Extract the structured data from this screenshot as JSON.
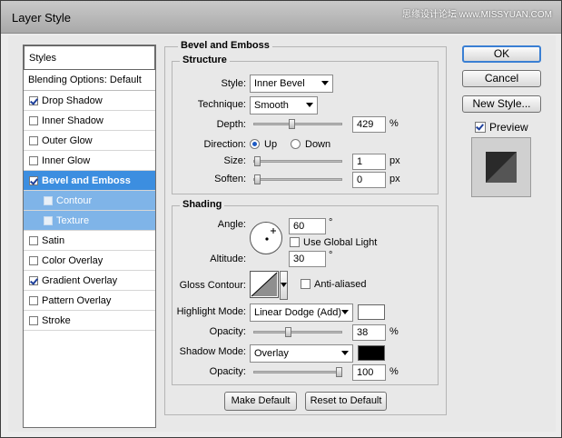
{
  "window": {
    "title": "Layer Style",
    "watermark": "思缘设计论坛 www.MISSYUAN.COM"
  },
  "sidebar": {
    "header": "Styles",
    "blending": "Blending Options: Default",
    "items": [
      {
        "label": "Drop Shadow",
        "checked": true
      },
      {
        "label": "Inner Shadow",
        "checked": false
      },
      {
        "label": "Outer Glow",
        "checked": false
      },
      {
        "label": "Inner Glow",
        "checked": false
      },
      {
        "label": "Bevel and Emboss",
        "checked": true,
        "selected": true
      },
      {
        "label": "Contour",
        "checked": false,
        "sub": true
      },
      {
        "label": "Texture",
        "checked": false,
        "sub": true
      },
      {
        "label": "Satin",
        "checked": false
      },
      {
        "label": "Color Overlay",
        "checked": false
      },
      {
        "label": "Gradient Overlay",
        "checked": true
      },
      {
        "label": "Pattern Overlay",
        "checked": false
      },
      {
        "label": "Stroke",
        "checked": false
      }
    ]
  },
  "panel": {
    "title": "Bevel and Emboss",
    "structure": {
      "title": "Structure",
      "style_label": "Style:",
      "style_value": "Inner Bevel",
      "technique_label": "Technique:",
      "technique_value": "Smooth",
      "depth_label": "Depth:",
      "depth_value": "429",
      "depth_unit": "%",
      "direction_label": "Direction:",
      "dir_up": "Up",
      "dir_down": "Down",
      "size_label": "Size:",
      "size_value": "1",
      "size_unit": "px",
      "soften_label": "Soften:",
      "soften_value": "0",
      "soften_unit": "px"
    },
    "shading": {
      "title": "Shading",
      "angle_label": "Angle:",
      "angle_value": "60",
      "angle_unit": "°",
      "global_light": "Use Global Light",
      "altitude_label": "Altitude:",
      "altitude_value": "30",
      "altitude_unit": "°",
      "gloss_label": "Gloss Contour:",
      "anti_aliased": "Anti-aliased",
      "highlight_label": "Highlight Mode:",
      "highlight_value": "Linear Dodge (Add)",
      "highlight_opacity_label": "Opacity:",
      "highlight_opacity_value": "38",
      "highlight_opacity_unit": "%",
      "highlight_color": "#ffffff",
      "shadow_label": "Shadow Mode:",
      "shadow_value": "Overlay",
      "shadow_opacity_label": "Opacity:",
      "shadow_opacity_value": "100",
      "shadow_opacity_unit": "%",
      "shadow_color": "#000000"
    },
    "make_default": "Make Default",
    "reset_default": "Reset to Default"
  },
  "buttons": {
    "ok": "OK",
    "cancel": "Cancel",
    "new_style": "New Style...",
    "preview": "Preview"
  }
}
